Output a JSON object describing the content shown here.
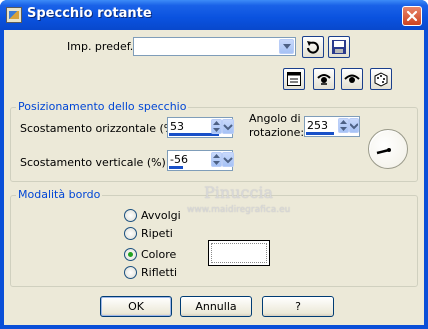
{
  "window": {
    "title": "Specchio rotante"
  },
  "presets": {
    "label": "Imp. predef.:",
    "value": ""
  },
  "mirror_group": {
    "title": "Posizionamento dello specchio",
    "h_offset_label": "Scostamento orizzontale (%):",
    "h_offset_value": "53",
    "v_offset_label": "Scostamento verticale (%):",
    "v_offset_value": "-56",
    "angle_label_line1": "Angolo di",
    "angle_label_line2": "rotazione:",
    "angle_value": "253"
  },
  "edge_group": {
    "title": "Modalità bordo",
    "options": [
      {
        "label": "Avvolgi",
        "checked": false
      },
      {
        "label": "Ripeti",
        "checked": false
      },
      {
        "label": "Colore",
        "checked": true
      },
      {
        "label": "Rifletti",
        "checked": false
      }
    ],
    "color_swatch": "#ffffff"
  },
  "buttons": {
    "ok": "OK",
    "cancel": "Annulla",
    "help": "?"
  },
  "watermark": {
    "line1": "Pinuccia",
    "line2": "www.maidiregrafica.eu"
  },
  "colors": {
    "title_bar": "#0a52df",
    "client_bg": "#ece9d8",
    "group_title": "#0046d5",
    "accent_bar": "#1850c8"
  },
  "icons": [
    "app-icon",
    "close-icon",
    "reset-icon",
    "save-icon",
    "dialog-icon",
    "eye-icon",
    "randomize-icon"
  ]
}
